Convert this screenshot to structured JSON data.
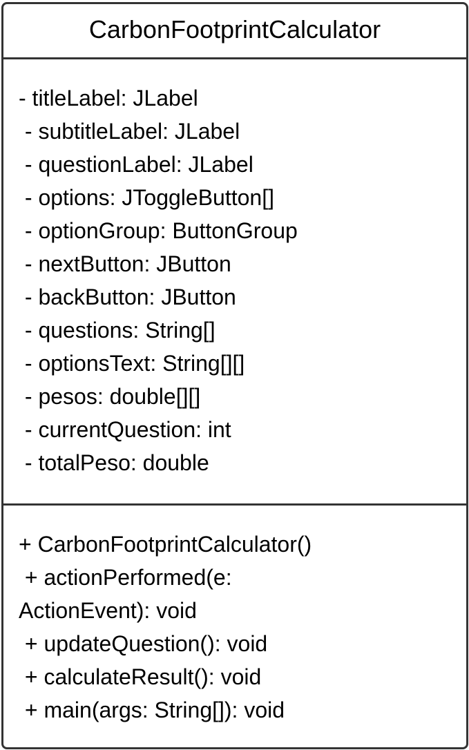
{
  "uml_class": {
    "name": "CarbonFootprintCalculator",
    "attributes": [
      "- titleLabel: JLabel",
      " - subtitleLabel: JLabel",
      " - questionLabel: JLabel",
      " - options: JToggleButton[]",
      " - optionGroup: ButtonGroup",
      " - nextButton: JButton",
      " - backButton: JButton",
      " - questions: String[]",
      " - optionsText: String[][]",
      " - pesos: double[][]",
      " - currentQuestion: int",
      " - totalPeso: double"
    ],
    "operations": [
      "+ CarbonFootprintCalculator()",
      " + actionPerformed(e:",
      "ActionEvent): void",
      " + updateQuestion(): void",
      " + calculateResult(): void",
      " + main(args: String[]): void"
    ]
  },
  "colors": {
    "border": "#333333",
    "background": "#ffffff",
    "text": "#000000"
  }
}
